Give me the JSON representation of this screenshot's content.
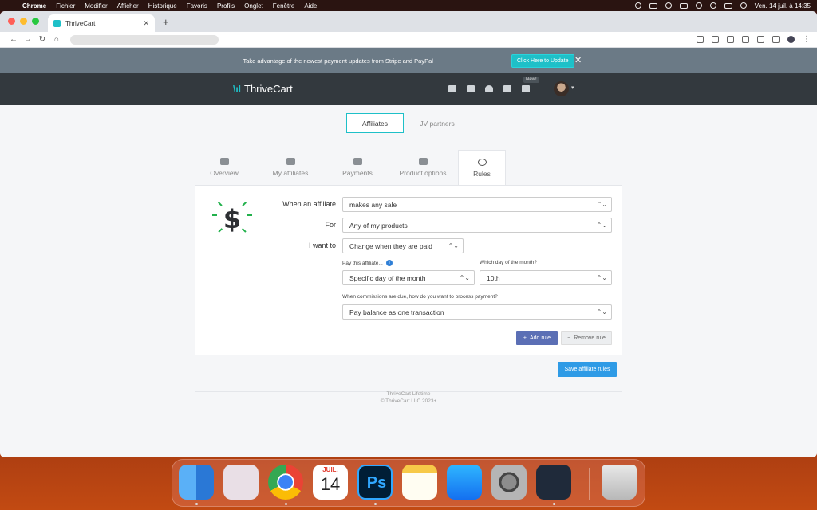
{
  "menubar": {
    "items": [
      "Chrome",
      "Fichier",
      "Modifier",
      "Afficher",
      "Historique",
      "Favoris",
      "Profils",
      "Onglet",
      "Fenêtre",
      "Aide"
    ],
    "clock": "Ven. 14 juil. à 14:35"
  },
  "browser": {
    "tab_title": "ThriveCart",
    "tab_close": "✕",
    "new_tab": "+"
  },
  "banner": {
    "text": "Take advantage of the newest payment updates from Stripe and PayPal",
    "button": "Click Here to Update",
    "close": "✕"
  },
  "header": {
    "logo_text": "ThriveCart",
    "new_badge": "New!"
  },
  "toggle": {
    "affiliates": "Affiliates",
    "jv_partners": "JV partners"
  },
  "tabs": [
    {
      "label": "Overview",
      "icon": "chart-icon"
    },
    {
      "label": "My affiliates",
      "icon": "users-icon"
    },
    {
      "label": "Payments",
      "icon": "money-icon"
    },
    {
      "label": "Product options",
      "icon": "sliders-icon"
    },
    {
      "label": "Rules",
      "icon": "crosshair-icon"
    }
  ],
  "rules": {
    "when_label": "When an affiliate",
    "when_value": "makes any sale",
    "for_label": "For",
    "for_value": "Any of my products",
    "iwant_label": "I want to",
    "iwant_value": "Change when they are paid",
    "pay_label": "Pay this affiliate...",
    "pay_value": "Specific day of the month",
    "day_label": "Which day of the month?",
    "day_value": "10th",
    "process_label": "When commissions are due, how do you want to process payment?",
    "process_value": "Pay balance as one transaction",
    "add_rule": "Add rule",
    "remove_rule": "Remove rule",
    "save": "Save affiliate rules"
  },
  "footer": {
    "line1": "ThriveCart Lifetime",
    "line2": "© ThriveCart LLC 2023+"
  },
  "dock": {
    "calendar_month": "JUIL.",
    "calendar_day": "14",
    "ps": "Ps"
  }
}
